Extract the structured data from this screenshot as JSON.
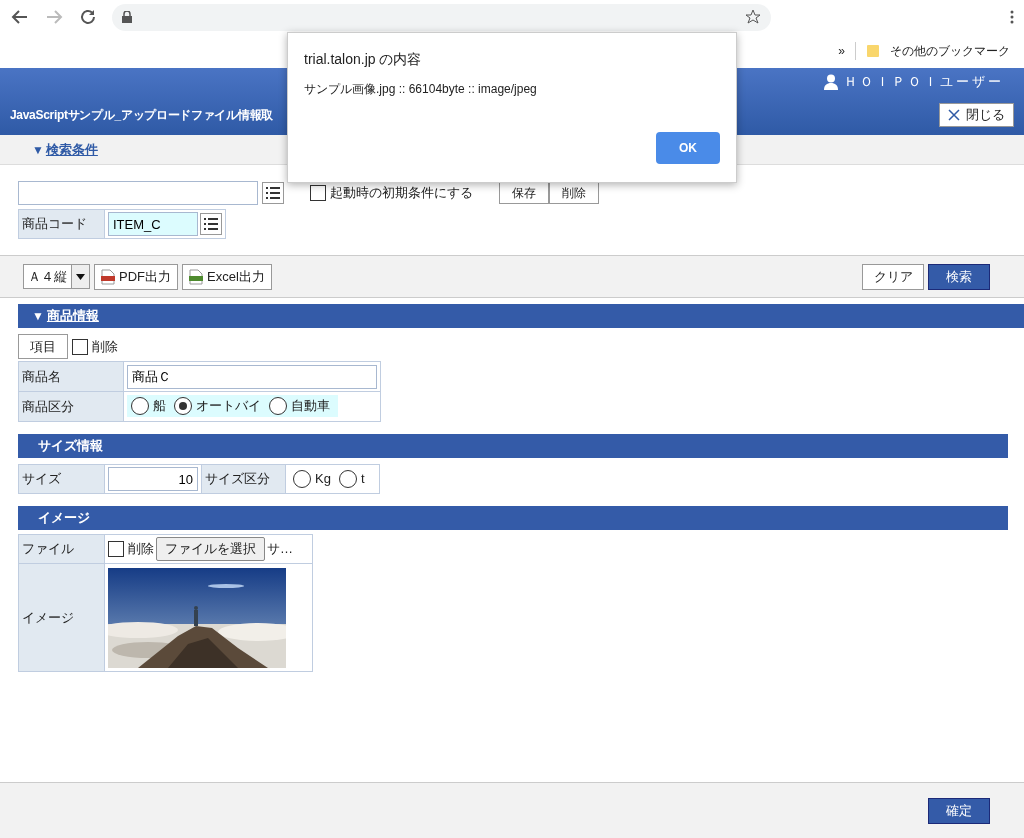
{
  "browser": {
    "bookmarks_overflow": "»",
    "bookmark_folder": "その他のブックマーク"
  },
  "header": {
    "user": "ＨＯＩＰＯＩユーザー",
    "title": "JavaScriptサンプル_アップロードファイル情報取",
    "close_button": "閉じる"
  },
  "search_conditions": {
    "toggle": "▼",
    "label": "検索条件",
    "default_checkbox": {
      "label": "起動時の初期条件にする",
      "checked": false
    },
    "save_button": "保存",
    "delete_button": "削除",
    "fields": [
      {
        "label": "商品コード",
        "value": "ITEM_C"
      }
    ]
  },
  "toolbar": {
    "paper_size": "Ａ４縦",
    "pdf_button": "PDF出力",
    "excel_button": "Excel出力",
    "clear_button": "クリア",
    "search_button": "検索"
  },
  "product_info": {
    "toggle": "▼",
    "title": "商品情報",
    "item_button": "項目",
    "delete_checkbox": {
      "label": "削除",
      "checked": false
    },
    "name_label": "商品名",
    "name_value": "商品Ｃ",
    "category_label": "商品区分",
    "category_options": [
      {
        "label": "船",
        "selected": false
      },
      {
        "label": "オートバイ",
        "selected": true
      },
      {
        "label": "自動車",
        "selected": false
      }
    ]
  },
  "size_info": {
    "title": "サイズ情報",
    "size_label": "サイズ",
    "size_value": "10",
    "unit_label": "サイズ区分",
    "unit_options": [
      {
        "label": "Kg",
        "selected": false
      },
      {
        "label": "t",
        "selected": false
      }
    ]
  },
  "image_info": {
    "title": "イメージ",
    "file_label": "ファイル",
    "delete_checkbox": {
      "label": "削除",
      "checked": false
    },
    "choose_button": "ファイルを選択",
    "file_name": "サ…",
    "image_label": "イメージ"
  },
  "footer": {
    "confirm_button": "確定"
  },
  "dialog": {
    "title": "trial.talon.jp の内容",
    "message": "サンプル画像.jpg :: 66104byte :: image/jpeg",
    "ok_button": "OK"
  }
}
